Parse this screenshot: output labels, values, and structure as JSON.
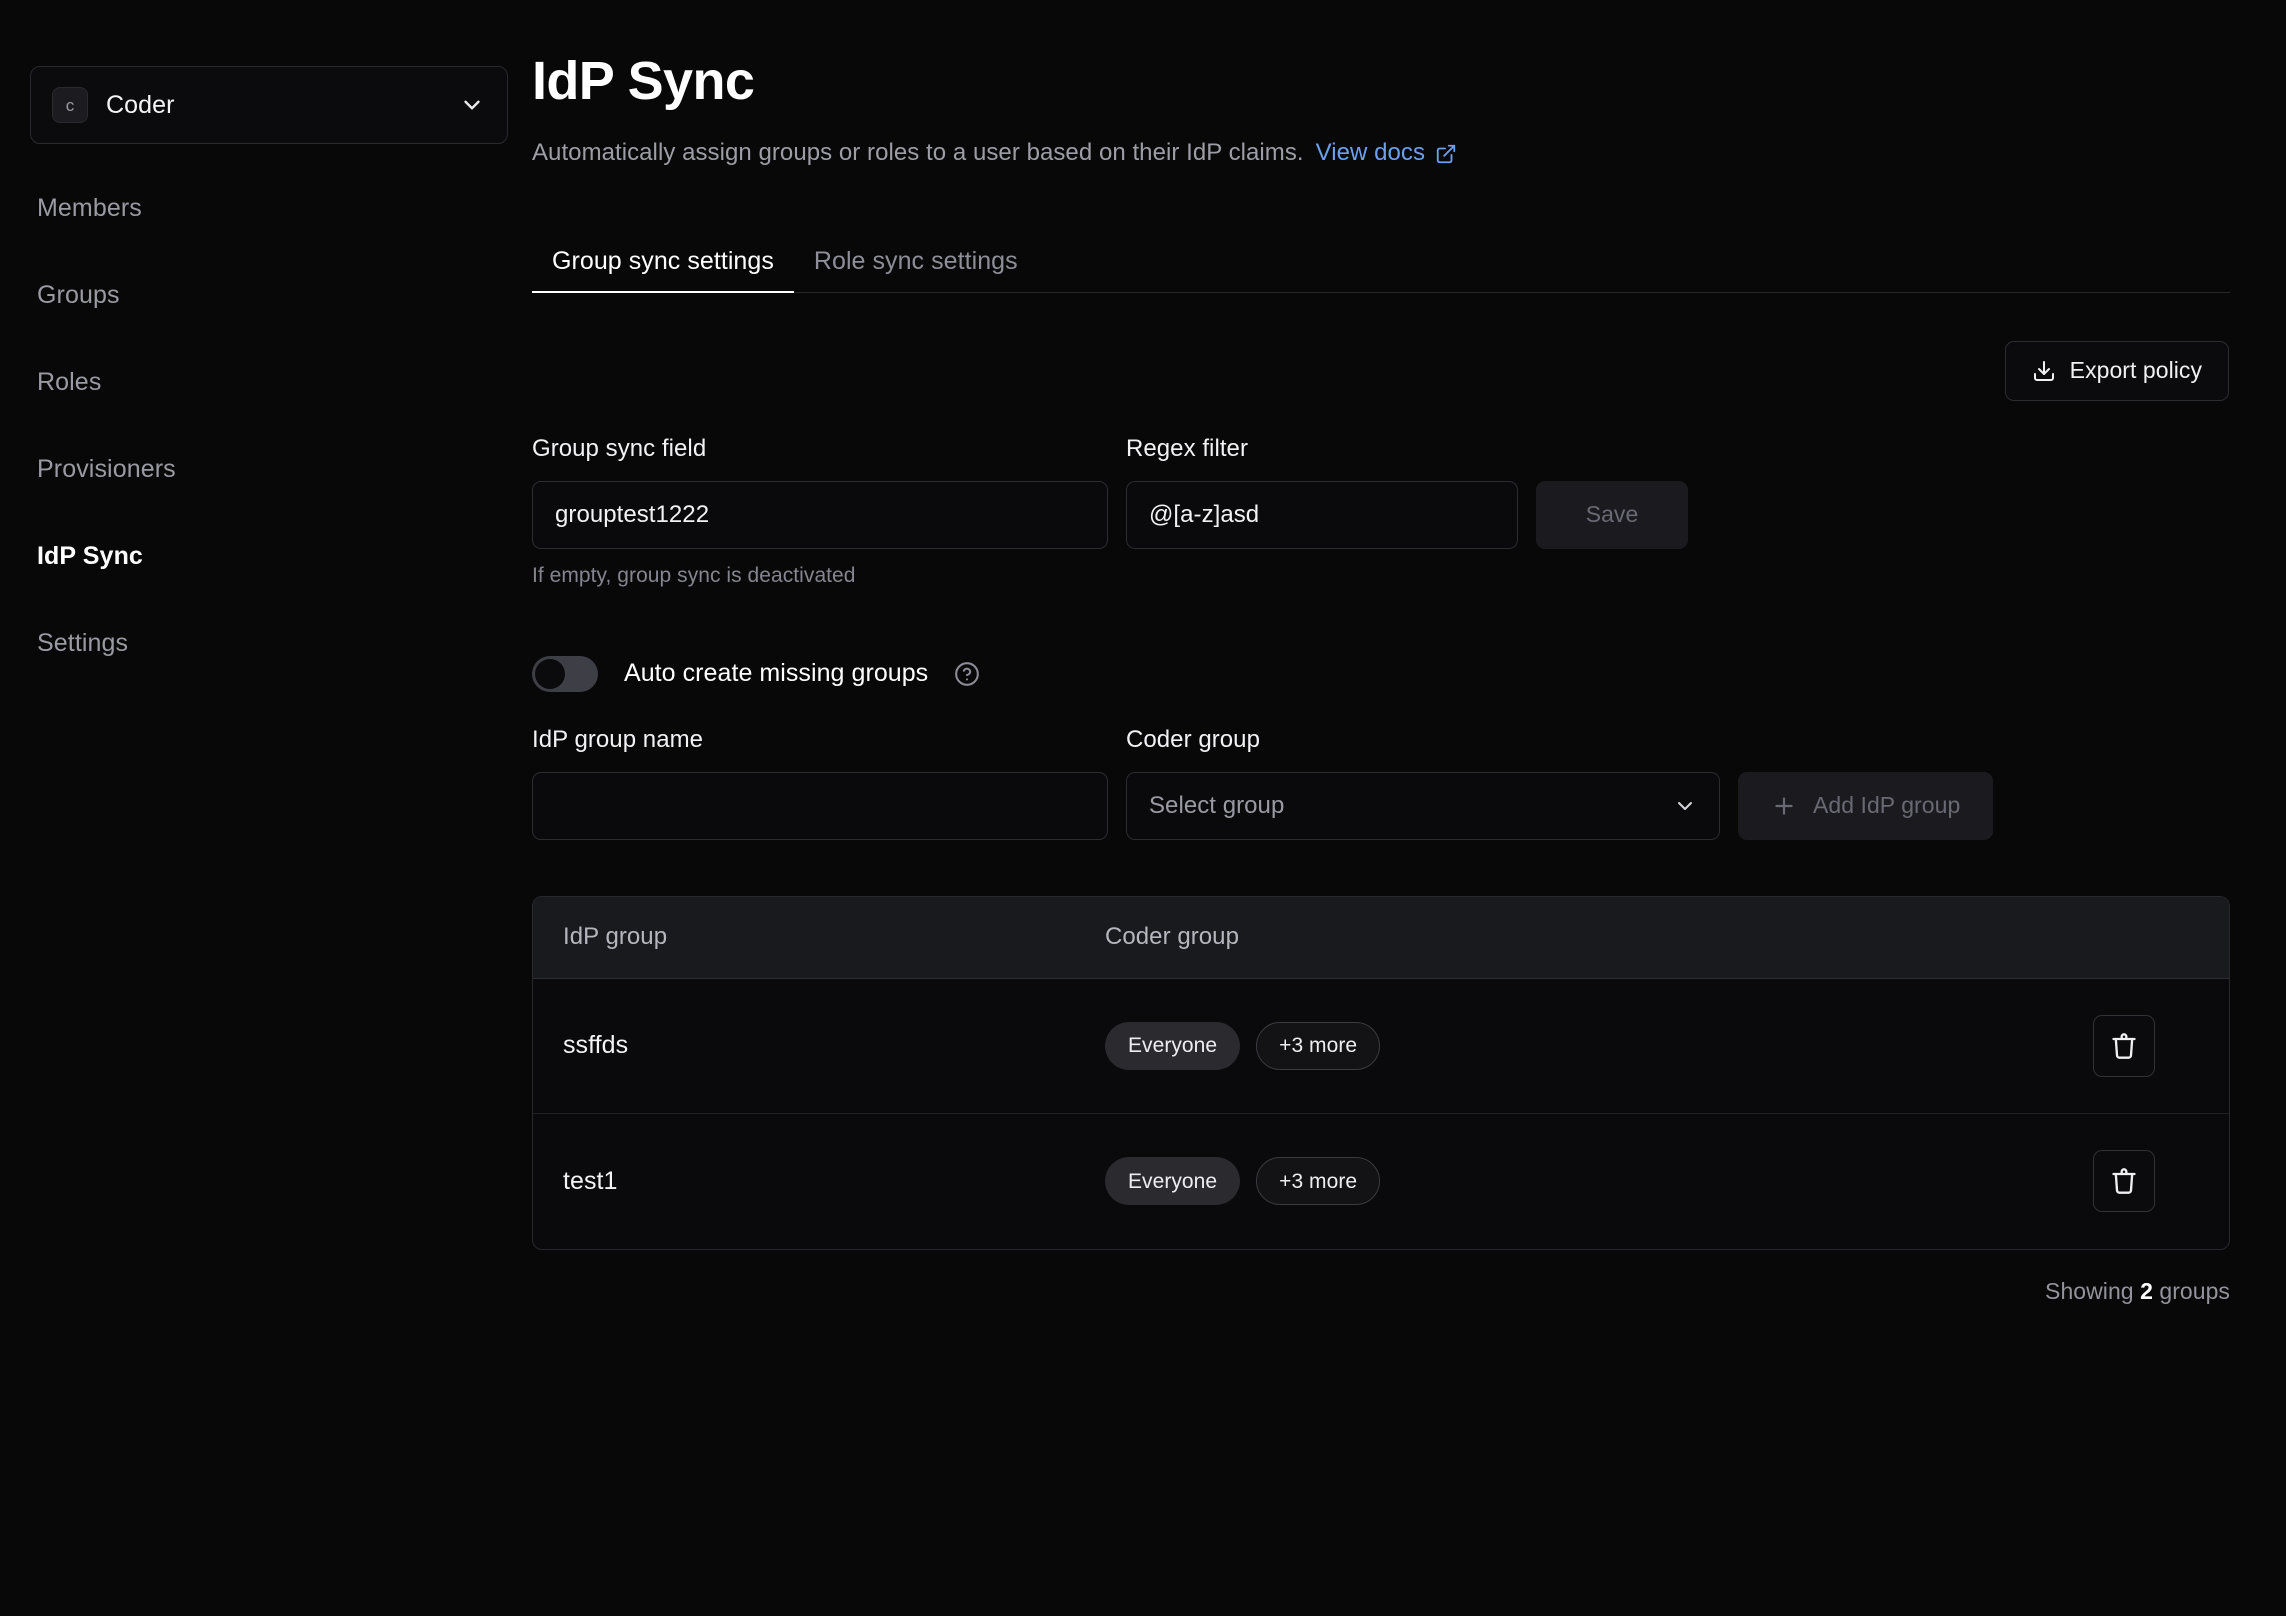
{
  "sidebar": {
    "org": {
      "name": "Coder",
      "avatar_letter": "c"
    },
    "items": [
      {
        "label": "Members"
      },
      {
        "label": "Groups"
      },
      {
        "label": "Roles"
      },
      {
        "label": "Provisioners"
      },
      {
        "label": "IdP Sync"
      },
      {
        "label": "Settings"
      }
    ]
  },
  "header": {
    "title": "IdP Sync",
    "subtitle": "Automatically assign groups or roles to a user based on their IdP claims.",
    "docs_link": "View docs"
  },
  "tabs": [
    {
      "label": "Group sync settings"
    },
    {
      "label": "Role sync settings"
    }
  ],
  "toolbar": {
    "export_label": "Export policy"
  },
  "form": {
    "sync_field_label": "Group sync field",
    "sync_field_value": "grouptest1222",
    "sync_field_placeholder": "",
    "regex_label": "Regex filter",
    "regex_value": "@[a-z]asd",
    "regex_placeholder": "",
    "save_label": "Save",
    "helper": "If empty, group sync is deactivated",
    "toggle_label": "Auto create missing groups"
  },
  "mapping": {
    "idp_group_label": "IdP group name",
    "idp_group_value": "",
    "idp_group_placeholder": "",
    "coder_group_label": "Coder group",
    "coder_group_placeholder": "Select group",
    "add_label": "Add IdP group"
  },
  "table": {
    "columns": [
      "IdP group",
      "Coder group"
    ],
    "rows": [
      {
        "idp_group": "ssffds",
        "pill_primary": "Everyone",
        "pill_more": "+3 more"
      },
      {
        "idp_group": "test1",
        "pill_primary": "Everyone",
        "pill_more": "+3 more"
      }
    ],
    "footer_prefix": "Showing ",
    "footer_count": "2",
    "footer_suffix": " groups"
  },
  "colors": {
    "background": "#080809",
    "accent_link": "#6c9fee",
    "text_primary": "#ffffff",
    "text_muted": "#9a9aa3",
    "border": "#2c2c31",
    "surface": "#191a1d"
  }
}
